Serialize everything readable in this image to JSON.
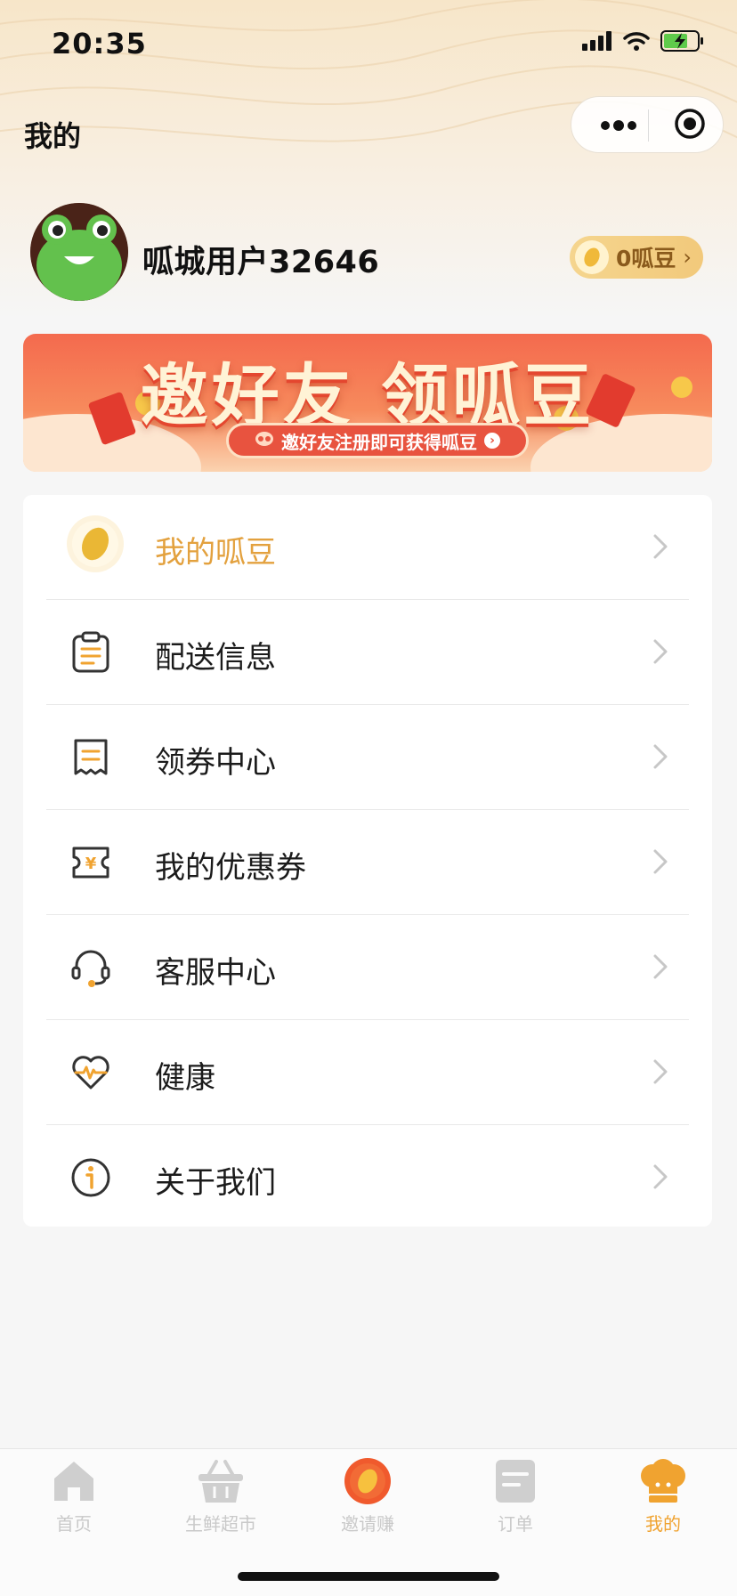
{
  "status_bar": {
    "time": "20:35"
  },
  "header": {
    "title": "我的"
  },
  "profile": {
    "username": "呱城用户32646",
    "beans_label": "0呱豆"
  },
  "banner": {
    "title": "邀好友 领呱豆",
    "subtitle": "邀好友注册即可获得呱豆"
  },
  "menu": {
    "items": [
      {
        "label": "我的呱豆",
        "icon": "bean-icon"
      },
      {
        "label": "配送信息",
        "icon": "clipboard-icon"
      },
      {
        "label": "领券中心",
        "icon": "receipt-icon"
      },
      {
        "label": "我的优惠券",
        "icon": "coupon-icon"
      },
      {
        "label": "客服中心",
        "icon": "headset-icon"
      },
      {
        "label": "健康",
        "icon": "heart-pulse-icon"
      },
      {
        "label": "关于我们",
        "icon": "info-icon"
      }
    ]
  },
  "tabbar": {
    "tabs": [
      {
        "label": "首页",
        "icon": "home-icon"
      },
      {
        "label": "生鲜超市",
        "icon": "basket-icon"
      },
      {
        "label": "邀请赚",
        "icon": "invite-bean-icon"
      },
      {
        "label": "订单",
        "icon": "order-icon"
      },
      {
        "label": "我的",
        "icon": "chef-hat-icon"
      }
    ],
    "active": "我的"
  },
  "colors": {
    "accent": "#f0a330",
    "banner_red": "#f46a4e",
    "pill_gold": "#f2c97b"
  }
}
